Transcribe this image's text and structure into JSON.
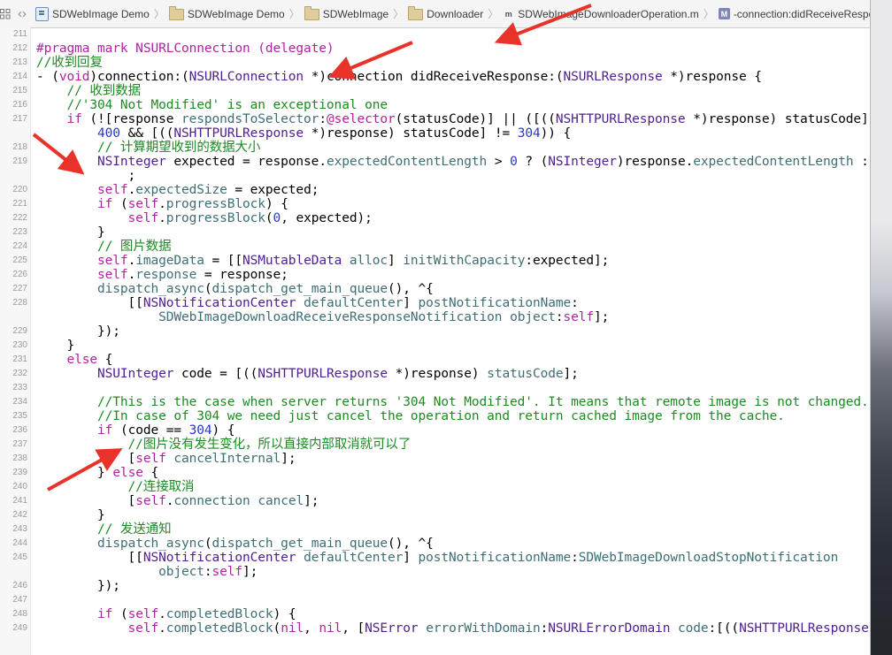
{
  "jumpbar": {
    "crumbs": [
      {
        "label": "SDWebImage Demo",
        "icon": "project-icon"
      },
      {
        "label": "SDWebImage Demo",
        "icon": "folder-icon"
      },
      {
        "label": "SDWebImage",
        "icon": "folder-icon"
      },
      {
        "label": "Downloader",
        "icon": "folder-icon"
      },
      {
        "label": "SDWebImageDownloaderOperation.m",
        "icon": "m-file-icon"
      },
      {
        "label": "-connection:didReceiveResponse:",
        "icon": "method-icon"
      }
    ],
    "method_badge": "M",
    "file_badge": "m"
  },
  "code_lines": [
    {
      "n": "211",
      "t": []
    },
    {
      "n": "212",
      "t": [
        [
          "kw",
          "#pragma mark NSURLConnection (delegate)"
        ]
      ]
    },
    {
      "n": "213",
      "t": [
        [
          "cmt",
          "//收到回复"
        ]
      ]
    },
    {
      "n": "214",
      "t": [
        [
          "pl",
          "- ("
        ],
        [
          "kw",
          "void"
        ],
        [
          "pl",
          ")connection:("
        ],
        [
          "cls",
          "NSURLConnection"
        ],
        [
          "pl",
          " *)connection didReceiveResponse:("
        ],
        [
          "cls",
          "NSURLResponse"
        ],
        [
          "pl",
          " *)response {"
        ]
      ]
    },
    {
      "n": "215",
      "t": [
        [
          "cmt",
          "    // 收到数据"
        ]
      ]
    },
    {
      "n": "216",
      "t": [
        [
          "cmt",
          "    //'304 Not Modified' is an exceptional one"
        ]
      ]
    },
    {
      "n": "217",
      "t": [
        [
          "kw",
          "    if"
        ],
        [
          "pl",
          " (![response "
        ],
        [
          "meth",
          "respondsToSelector"
        ],
        [
          "pl",
          ":"
        ],
        [
          "kw",
          "@selector"
        ],
        [
          "pl",
          "(statusCode)] || ([(("
        ],
        [
          "cls",
          "NSHTTPURLResponse"
        ],
        [
          "pl",
          " *)response) statusCode] <"
        ]
      ]
    },
    {
      "n": "",
      "t": [
        [
          "pl",
          "        "
        ],
        [
          "num",
          "400"
        ],
        [
          "pl",
          " && [(("
        ],
        [
          "cls",
          "NSHTTPURLResponse"
        ],
        [
          "pl",
          " *)response) statusCode] != "
        ],
        [
          "num",
          "304"
        ],
        [
          "pl",
          ")) {"
        ]
      ]
    },
    {
      "n": "218",
      "t": [
        [
          "cmt",
          "        // 计算期望收到的数据大小"
        ]
      ]
    },
    {
      "n": "219",
      "t": [
        [
          "cls",
          "        NSInteger"
        ],
        [
          "pl",
          " expected = response."
        ],
        [
          "prop",
          "expectedContentLength"
        ],
        [
          "pl",
          " > "
        ],
        [
          "num",
          "0"
        ],
        [
          "pl",
          " ? ("
        ],
        [
          "cls",
          "NSInteger"
        ],
        [
          "pl",
          ")response."
        ],
        [
          "prop",
          "expectedContentLength"
        ],
        [
          "pl",
          " : "
        ],
        [
          "num",
          "0"
        ]
      ]
    },
    {
      "n": "",
      "t": [
        [
          "pl",
          "            ;"
        ]
      ]
    },
    {
      "n": "220",
      "t": [
        [
          "kw",
          "        self"
        ],
        [
          "pl",
          "."
        ],
        [
          "prop",
          "expectedSize"
        ],
        [
          "pl",
          " = expected;"
        ]
      ]
    },
    {
      "n": "221",
      "t": [
        [
          "kw",
          "        if"
        ],
        [
          "pl",
          " ("
        ],
        [
          "kw",
          "self"
        ],
        [
          "pl",
          "."
        ],
        [
          "prop",
          "progressBlock"
        ],
        [
          "pl",
          ") {"
        ]
      ]
    },
    {
      "n": "222",
      "t": [
        [
          "kw",
          "            self"
        ],
        [
          "pl",
          "."
        ],
        [
          "prop",
          "progressBlock"
        ],
        [
          "pl",
          "("
        ],
        [
          "num",
          "0"
        ],
        [
          "pl",
          ", expected);"
        ]
      ]
    },
    {
      "n": "223",
      "t": [
        [
          "pl",
          "        }"
        ]
      ]
    },
    {
      "n": "224",
      "t": [
        [
          "cmt",
          "        // 图片数据"
        ]
      ]
    },
    {
      "n": "225",
      "t": [
        [
          "kw",
          "        self"
        ],
        [
          "pl",
          "."
        ],
        [
          "prop",
          "imageData"
        ],
        [
          "pl",
          " = [["
        ],
        [
          "cls",
          "NSMutableData"
        ],
        [
          "pl",
          " "
        ],
        [
          "meth",
          "alloc"
        ],
        [
          "pl",
          "] "
        ],
        [
          "meth",
          "initWithCapacity"
        ],
        [
          "pl",
          ":expected];"
        ]
      ]
    },
    {
      "n": "226",
      "t": [
        [
          "kw",
          "        self"
        ],
        [
          "pl",
          "."
        ],
        [
          "prop",
          "response"
        ],
        [
          "pl",
          " = response;"
        ]
      ]
    },
    {
      "n": "227",
      "t": [
        [
          "pl",
          "        "
        ],
        [
          "meth",
          "dispatch_async"
        ],
        [
          "pl",
          "("
        ],
        [
          "meth",
          "dispatch_get_main_queue"
        ],
        [
          "pl",
          "(), ^{"
        ]
      ]
    },
    {
      "n": "228",
      "t": [
        [
          "pl",
          "            [["
        ],
        [
          "cls",
          "NSNotificationCenter"
        ],
        [
          "pl",
          " "
        ],
        [
          "meth",
          "defaultCenter"
        ],
        [
          "pl",
          "] "
        ],
        [
          "meth",
          "postNotificationName"
        ],
        [
          "pl",
          ":"
        ]
      ]
    },
    {
      "n": "",
      "t": [
        [
          "pl",
          "                "
        ],
        [
          "meth",
          "SDWebImageDownloadReceiveResponseNotification"
        ],
        [
          "pl",
          " "
        ],
        [
          "meth",
          "object"
        ],
        [
          "pl",
          ":"
        ],
        [
          "kw",
          "self"
        ],
        [
          "pl",
          "];"
        ]
      ]
    },
    {
      "n": "229",
      "t": [
        [
          "pl",
          "        });"
        ]
      ]
    },
    {
      "n": "230",
      "t": [
        [
          "pl",
          "    }"
        ]
      ]
    },
    {
      "n": "231",
      "t": [
        [
          "kw",
          "    else"
        ],
        [
          "pl",
          " {"
        ]
      ]
    },
    {
      "n": "232",
      "t": [
        [
          "cls",
          "        NSUInteger"
        ],
        [
          "pl",
          " code = [(("
        ],
        [
          "cls",
          "NSHTTPURLResponse"
        ],
        [
          "pl",
          " *)response) "
        ],
        [
          "meth",
          "statusCode"
        ],
        [
          "pl",
          "];"
        ]
      ]
    },
    {
      "n": "233",
      "t": []
    },
    {
      "n": "234",
      "t": [
        [
          "cmt",
          "        //This is the case when server returns '304 Not Modified'. It means that remote image is not changed."
        ]
      ]
    },
    {
      "n": "235",
      "t": [
        [
          "cmt",
          "        //In case of 304 we need just cancel the operation and return cached image from the cache."
        ]
      ]
    },
    {
      "n": "236",
      "t": [
        [
          "kw",
          "        if"
        ],
        [
          "pl",
          " (code == "
        ],
        [
          "num",
          "304"
        ],
        [
          "pl",
          ") {"
        ]
      ]
    },
    {
      "n": "237",
      "t": [
        [
          "cmt",
          "            //图片没有发生变化，所以直接内部取消就可以了"
        ]
      ]
    },
    {
      "n": "238",
      "t": [
        [
          "pl",
          "            ["
        ],
        [
          "kw",
          "self"
        ],
        [
          "pl",
          " "
        ],
        [
          "meth",
          "cancelInternal"
        ],
        [
          "pl",
          "];"
        ]
      ]
    },
    {
      "n": "239",
      "t": [
        [
          "pl",
          "        } "
        ],
        [
          "kw",
          "else"
        ],
        [
          "pl",
          " {"
        ]
      ]
    },
    {
      "n": "240",
      "t": [
        [
          "cmt",
          "            //连接取消"
        ]
      ]
    },
    {
      "n": "241",
      "t": [
        [
          "pl",
          "            ["
        ],
        [
          "kw",
          "self"
        ],
        [
          "pl",
          "."
        ],
        [
          "prop",
          "connection"
        ],
        [
          "pl",
          " "
        ],
        [
          "meth",
          "cancel"
        ],
        [
          "pl",
          "];"
        ]
      ]
    },
    {
      "n": "242",
      "t": [
        [
          "pl",
          "        }"
        ]
      ]
    },
    {
      "n": "243",
      "t": [
        [
          "cmt",
          "        // 发送通知"
        ]
      ]
    },
    {
      "n": "244",
      "t": [
        [
          "pl",
          "        "
        ],
        [
          "meth",
          "dispatch_async"
        ],
        [
          "pl",
          "("
        ],
        [
          "meth",
          "dispatch_get_main_queue"
        ],
        [
          "pl",
          "(), ^{"
        ]
      ]
    },
    {
      "n": "245",
      "t": [
        [
          "pl",
          "            [["
        ],
        [
          "cls",
          "NSNotificationCenter"
        ],
        [
          "pl",
          " "
        ],
        [
          "meth",
          "defaultCenter"
        ],
        [
          "pl",
          "] "
        ],
        [
          "meth",
          "postNotificationName"
        ],
        [
          "pl",
          ":"
        ],
        [
          "meth",
          "SDWebImageDownloadStopNotification"
        ]
      ]
    },
    {
      "n": "",
      "t": [
        [
          "pl",
          "                "
        ],
        [
          "meth",
          "object"
        ],
        [
          "pl",
          ":"
        ],
        [
          "kw",
          "self"
        ],
        [
          "pl",
          "];"
        ]
      ]
    },
    {
      "n": "246",
      "t": [
        [
          "pl",
          "        });"
        ]
      ]
    },
    {
      "n": "247",
      "t": []
    },
    {
      "n": "248",
      "t": [
        [
          "kw",
          "        if"
        ],
        [
          "pl",
          " ("
        ],
        [
          "kw",
          "self"
        ],
        [
          "pl",
          "."
        ],
        [
          "prop",
          "completedBlock"
        ],
        [
          "pl",
          ") {"
        ]
      ]
    },
    {
      "n": "249",
      "t": [
        [
          "kw",
          "            self"
        ],
        [
          "pl",
          "."
        ],
        [
          "prop",
          "completedBlock"
        ],
        [
          "pl",
          "("
        ],
        [
          "kw",
          "nil"
        ],
        [
          "pl",
          ", "
        ],
        [
          "kw",
          "nil"
        ],
        [
          "pl",
          ", ["
        ],
        [
          "cls",
          "NSError"
        ],
        [
          "pl",
          " "
        ],
        [
          "meth",
          "errorWithDomain"
        ],
        [
          "pl",
          ":"
        ],
        [
          "cls",
          "NSURLErrorDomain"
        ],
        [
          "pl",
          " "
        ],
        [
          "meth",
          "code"
        ],
        [
          "pl",
          ":[(("
        ],
        [
          "cls",
          "NSHTTPURLResponse"
        ],
        [
          "pl",
          " *"
        ]
      ]
    }
  ],
  "colors": {
    "keyword": "#b0249f",
    "class": "#4d1f8f",
    "method": "#3f6e74",
    "number": "#2a37c9",
    "comment": "#1e8a23",
    "annotation_arrow": "#e8322a"
  }
}
